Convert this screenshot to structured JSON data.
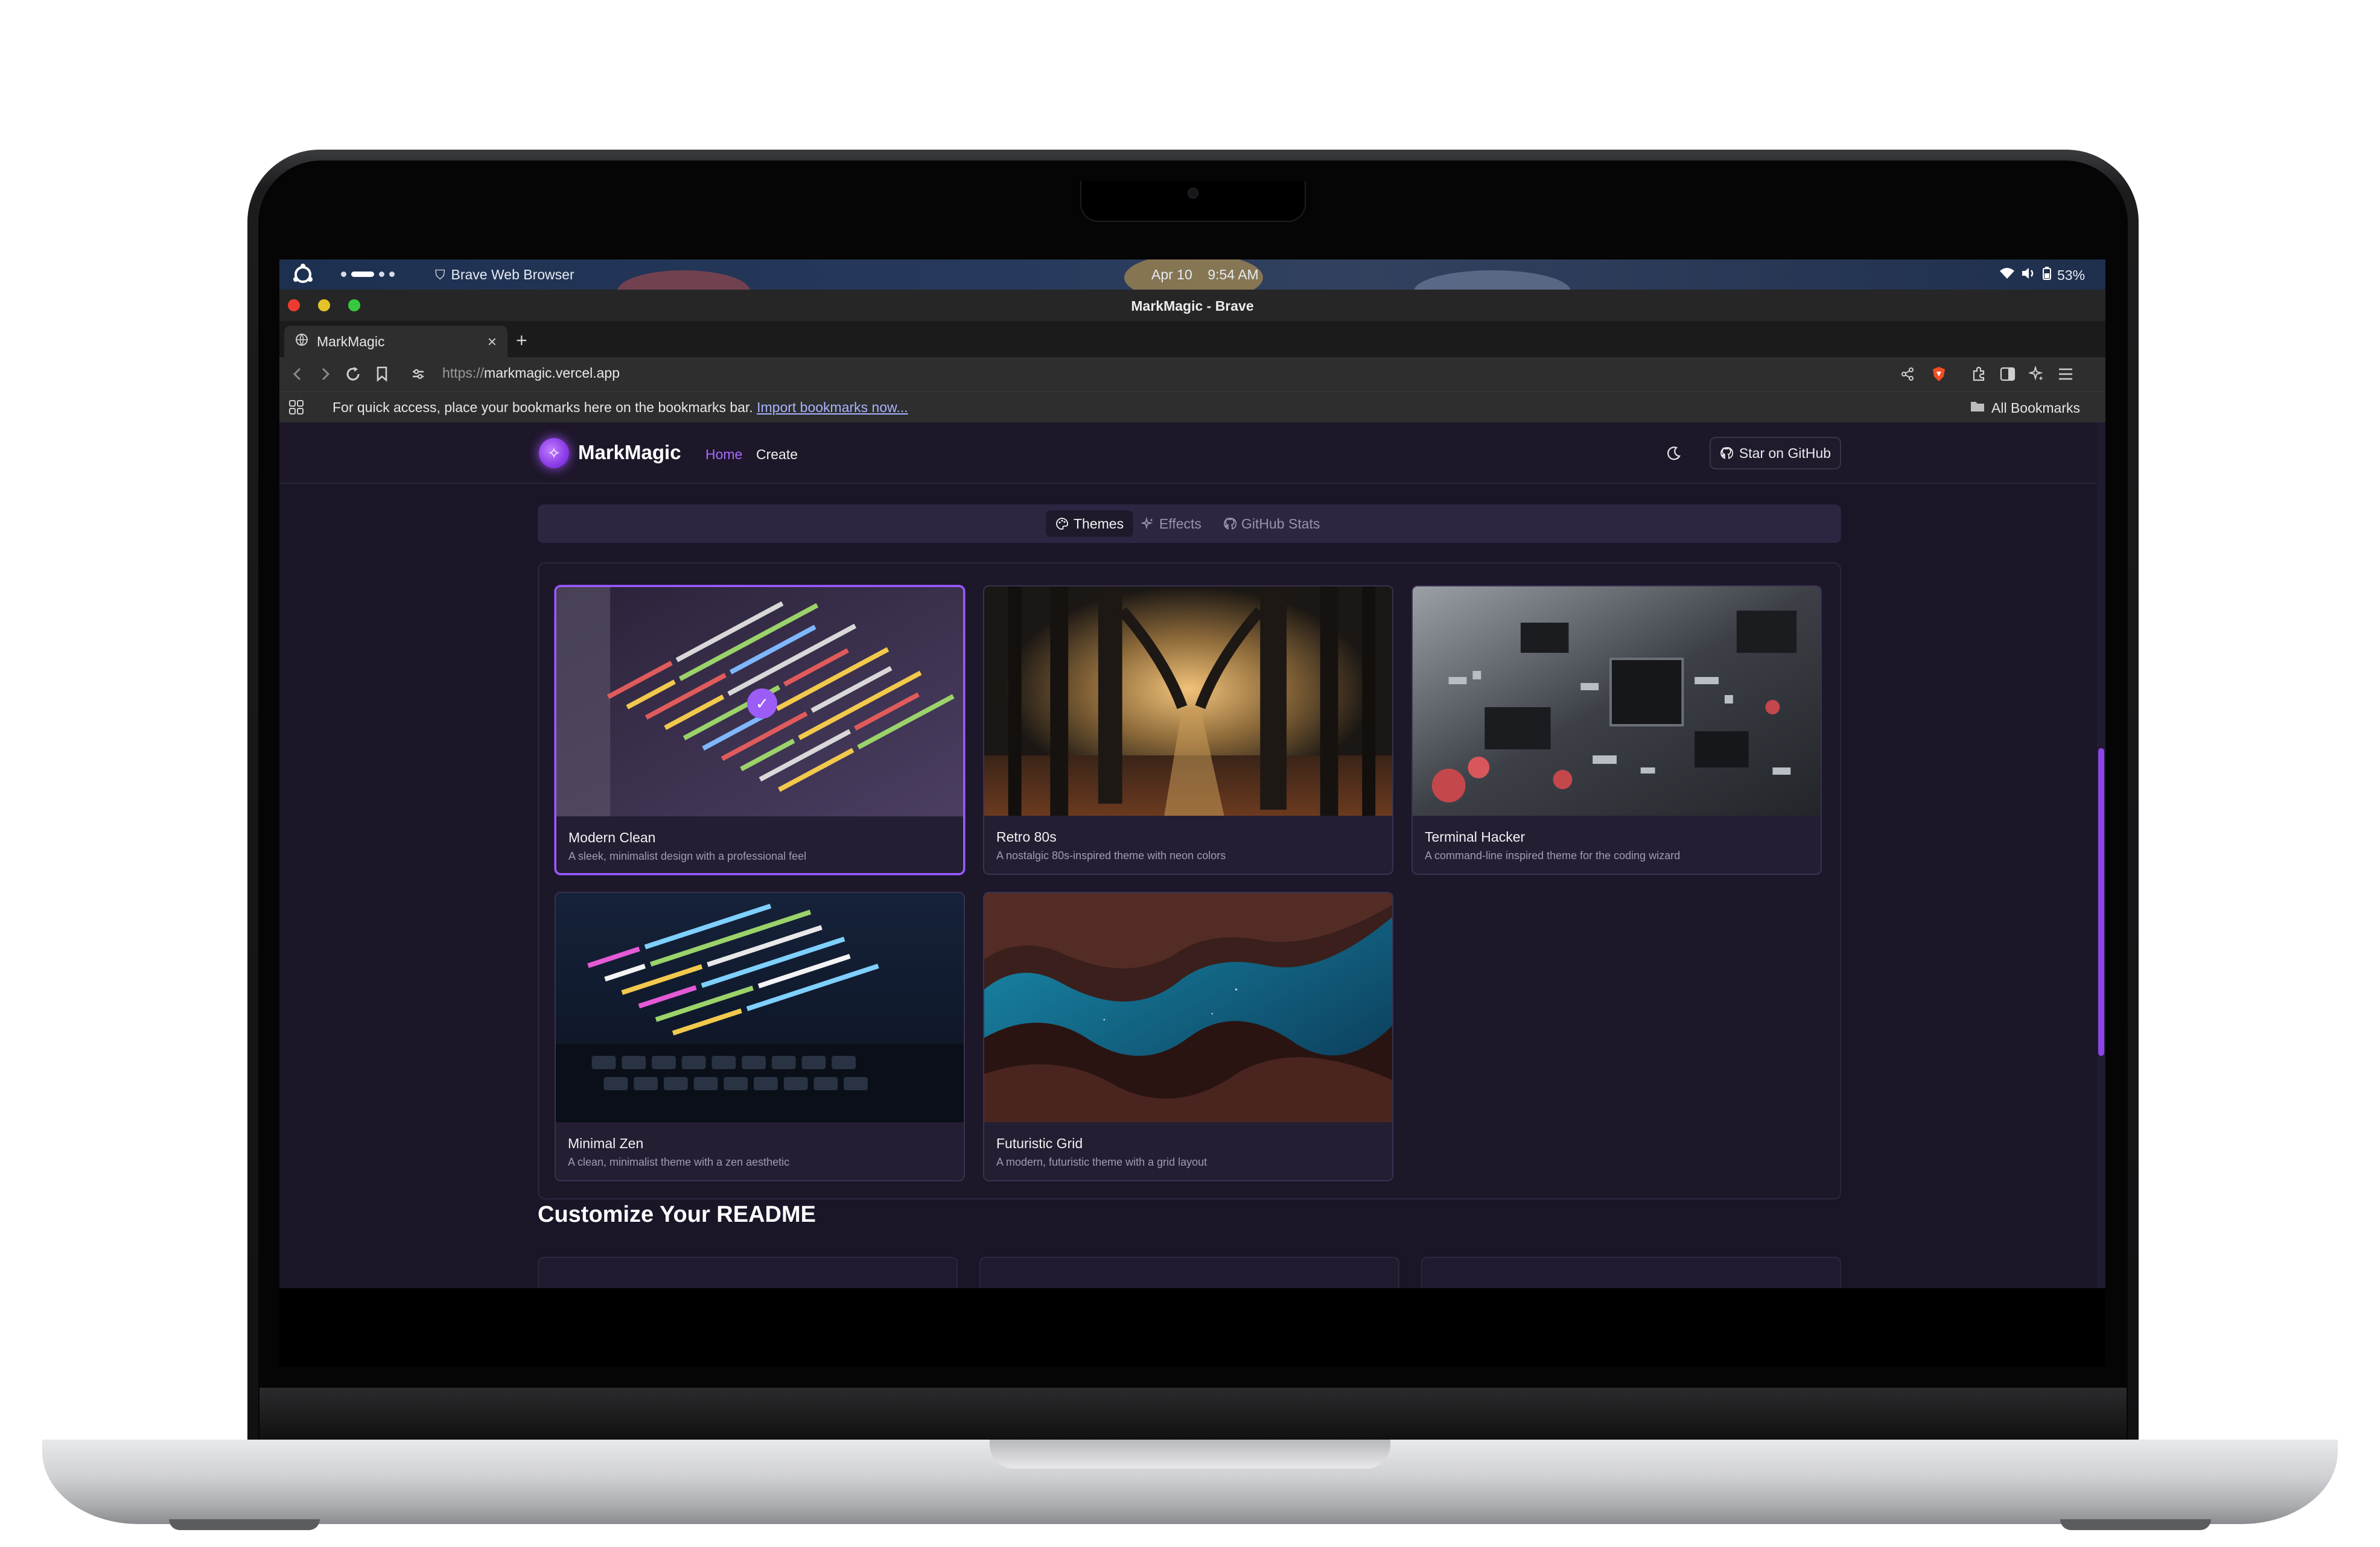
{
  "os_bar": {
    "app_name": "Brave Web Browser",
    "clock": "Apr 10    9:54 AM",
    "battery": "53%"
  },
  "window": {
    "title": "MarkMagic - Brave"
  },
  "tabs": [
    {
      "label": "MarkMagic",
      "close": "×"
    }
  ],
  "new_tab": "+",
  "address": {
    "scheme": "https://",
    "host": "markmagic.vercel.app"
  },
  "bookmarks_bar": {
    "message": "For quick access, place your bookmarks here on the bookmarks bar.",
    "import_link": "Import bookmarks now...",
    "all_bookmarks": "All Bookmarks"
  },
  "site": {
    "brand": "MarkMagic",
    "nav": [
      {
        "label": "Home",
        "active": true
      },
      {
        "label": "Create",
        "active": false
      }
    ],
    "github_button": "Star on GitHub",
    "segments": [
      {
        "label": "Themes",
        "icon": "palette-icon",
        "active": true
      },
      {
        "label": "Effects",
        "icon": "sparkles-icon",
        "active": false
      },
      {
        "label": "GitHub Stats",
        "icon": "github-icon",
        "active": false
      }
    ],
    "themes": [
      {
        "title": "Modern Clean",
        "description": "A sleek, minimalist design with a professional feel",
        "selected": true
      },
      {
        "title": "Retro 80s",
        "description": "A nostalgic 80s-inspired theme with neon colors",
        "selected": false
      },
      {
        "title": "Terminal Hacker",
        "description": "A command-line inspired theme for the coding wizard",
        "selected": false
      },
      {
        "title": "Minimal Zen",
        "description": "A clean, minimalist theme with a zen aesthetic",
        "selected": false
      },
      {
        "title": "Futuristic Grid",
        "description": "A modern, futuristic theme with a grid layout",
        "selected": false
      }
    ],
    "section_title": "Customize Your README"
  },
  "colors": {
    "accent": "#9b5bff",
    "page_bg": "#1a1527",
    "nav_active": "#a66bff"
  }
}
